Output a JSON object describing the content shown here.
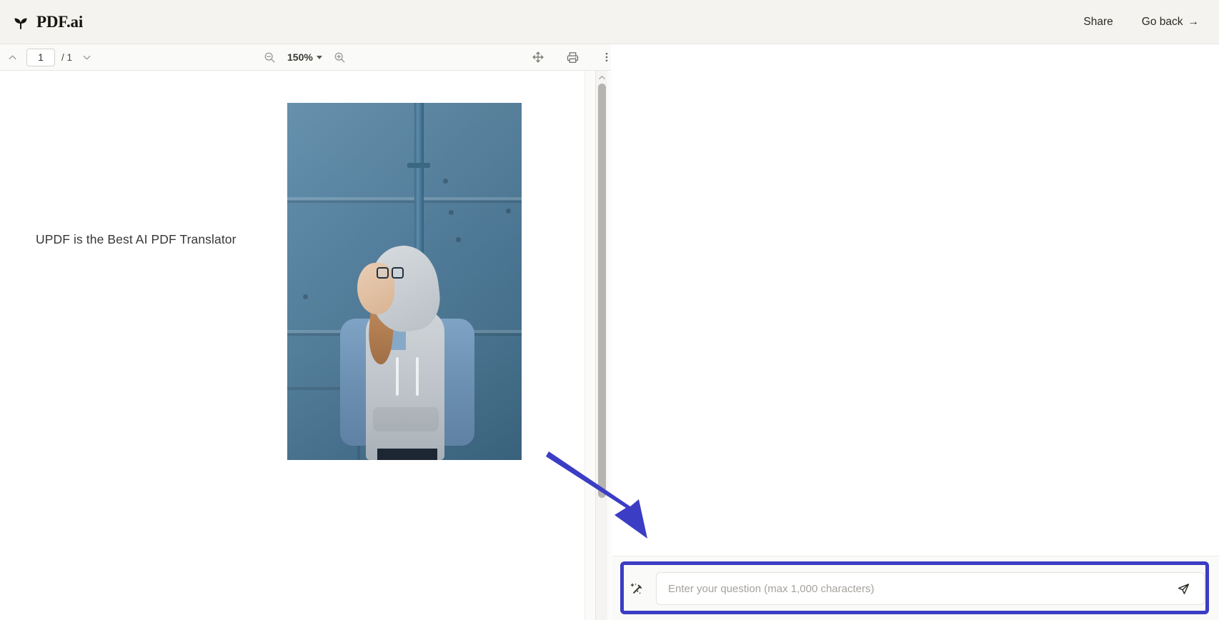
{
  "header": {
    "brand_name": "PDF.ai",
    "logo_icon": "sprout-leaf-icon",
    "share_label": "Share",
    "go_back_label": "Go back",
    "go_back_arrow": "→"
  },
  "pdf_toolbar": {
    "prev_page_icon": "chevron-up-icon",
    "next_page_icon": "chevron-down-icon",
    "page_number_value": "1",
    "page_total_label": "/ 1",
    "zoom_out_icon": "zoom-out-icon",
    "zoom_level": "150%",
    "zoom_in_icon": "zoom-in-icon",
    "pan_icon": "move-pan-icon",
    "print_icon": "printer-icon",
    "more_icon": "more-vertical-icon"
  },
  "document": {
    "heading": "UPDF is the Best AI PDF Translator",
    "image_alt": "woman-in-denim-jacket-photo"
  },
  "chat": {
    "composer": {
      "wand_icon": "magic-wand-icon",
      "input_value": "",
      "input_placeholder": "Enter your question (max 1,000 characters)",
      "send_icon": "send-paper-plane-icon"
    }
  },
  "annotations": {
    "highlight_color": "#3b3dc4",
    "arrow_color": "#3b3dc4",
    "arrow_target": "chat-composer"
  }
}
